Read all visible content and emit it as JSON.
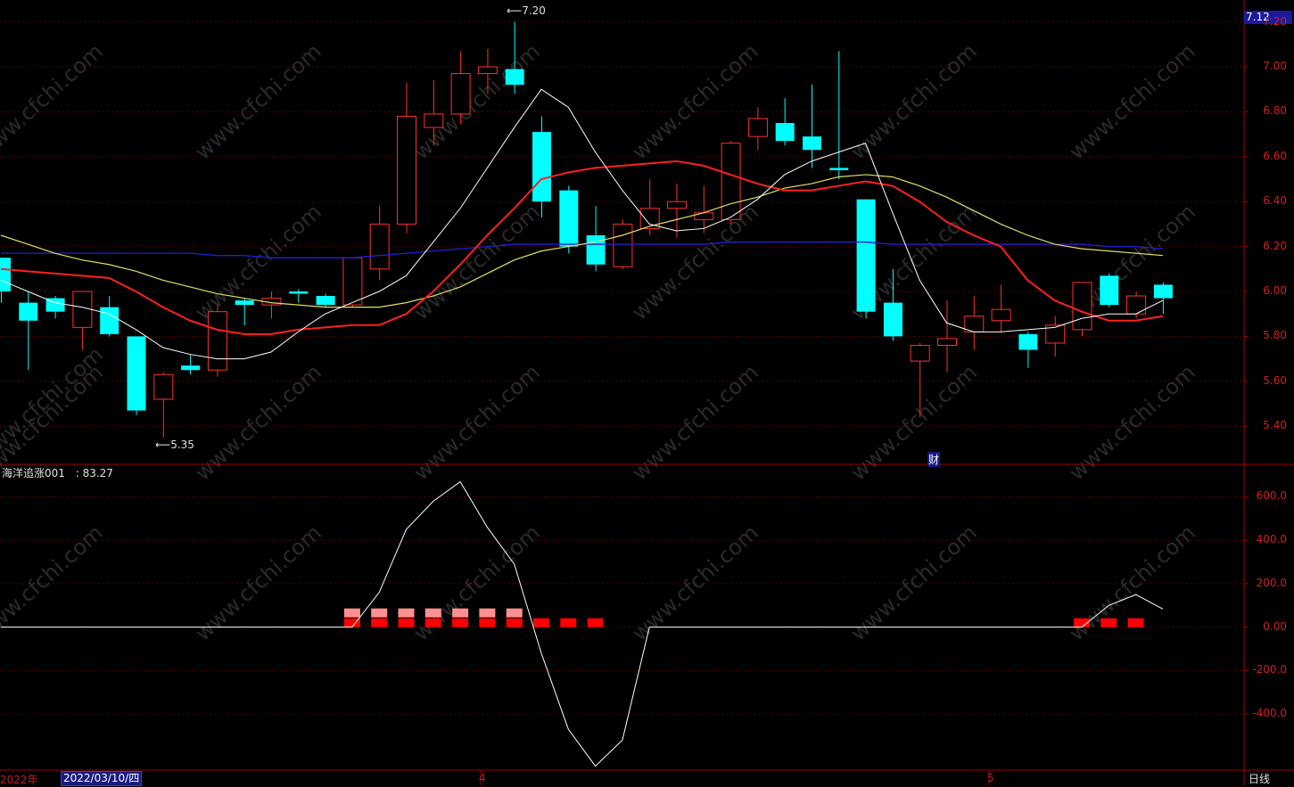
{
  "indicator": {
    "name": "海洋追涨001",
    "value_label": ": 83.27"
  },
  "price_axis": [
    "7.20",
    "7.00",
    "6.80",
    "6.60",
    "6.40",
    "6.20",
    "6.00",
    "5.80",
    "5.60",
    "5.40"
  ],
  "indicator_axis": [
    "600.0",
    "400.0",
    "200.0",
    "0.00",
    "-200.0",
    "-400.0"
  ],
  "current_price": "7.12",
  "annotations": {
    "high": "7.20",
    "low": "5.35",
    "finance_marker": "财"
  },
  "date_axis": {
    "year": "2022年",
    "selected_date": "2022/03/10/四",
    "month_4": "4",
    "month_5": "5"
  },
  "period_tab": "日线",
  "watermark": "www.cfchi.com",
  "colors": {
    "up": "#ff3030",
    "down": "#00ffff",
    "ma5": "#ffffff",
    "ma10": "#ff2020",
    "ma20": "#e0e060",
    "ma60": "#2020d0",
    "grid": "#5a0000"
  },
  "chart_data": {
    "type": "candlestick",
    "candles": [
      {
        "o": 6.15,
        "c": 6.0,
        "h": 6.15,
        "l": 5.95
      },
      {
        "o": 5.95,
        "c": 5.87,
        "h": 6.0,
        "l": 5.65
      },
      {
        "o": 5.97,
        "c": 5.91,
        "h": 5.98,
        "l": 5.88
      },
      {
        "o": 5.84,
        "c": 6.0,
        "h": 6.0,
        "l": 5.74
      },
      {
        "o": 5.93,
        "c": 5.81,
        "h": 5.98,
        "l": 5.8
      },
      {
        "o": 5.8,
        "c": 5.47,
        "h": 5.8,
        "l": 5.45
      },
      {
        "o": 5.52,
        "c": 5.63,
        "h": 5.64,
        "l": 5.35
      },
      {
        "o": 5.67,
        "c": 5.65,
        "h": 5.72,
        "l": 5.63
      },
      {
        "o": 5.65,
        "c": 5.91,
        "h": 5.94,
        "l": 5.62
      },
      {
        "o": 5.96,
        "c": 5.94,
        "h": 5.97,
        "l": 5.85
      },
      {
        "o": 5.94,
        "c": 5.97,
        "h": 6.0,
        "l": 5.88
      },
      {
        "o": 6.0,
        "c": 5.99,
        "h": 6.01,
        "l": 5.95
      },
      {
        "o": 5.98,
        "c": 5.94,
        "h": 5.99,
        "l": 5.93
      },
      {
        "o": 5.94,
        "c": 6.15,
        "h": 6.15,
        "l": 5.93
      },
      {
        "o": 6.1,
        "c": 6.3,
        "h": 6.38,
        "l": 6.05
      },
      {
        "o": 6.3,
        "c": 6.78,
        "h": 6.93,
        "l": 6.26
      },
      {
        "o": 6.73,
        "c": 6.79,
        "h": 6.94,
        "l": 6.65
      },
      {
        "o": 6.79,
        "c": 6.97,
        "h": 7.07,
        "l": 6.75
      },
      {
        "o": 6.97,
        "c": 7.0,
        "h": 7.08,
        "l": 6.88
      },
      {
        "o": 6.99,
        "c": 6.92,
        "h": 7.2,
        "l": 6.88
      },
      {
        "o": 6.71,
        "c": 6.4,
        "h": 6.78,
        "l": 6.33
      },
      {
        "o": 6.45,
        "c": 6.2,
        "h": 6.47,
        "l": 6.17
      },
      {
        "o": 6.25,
        "c": 6.12,
        "h": 6.38,
        "l": 6.09
      },
      {
        "o": 6.11,
        "c": 6.3,
        "h": 6.32,
        "l": 6.1
      },
      {
        "o": 6.28,
        "c": 6.37,
        "h": 6.5,
        "l": 6.25
      },
      {
        "o": 6.37,
        "c": 6.4,
        "h": 6.48,
        "l": 6.24
      },
      {
        "o": 6.32,
        "c": 6.35,
        "h": 6.47,
        "l": 6.26
      },
      {
        "o": 6.32,
        "c": 6.66,
        "h": 6.67,
        "l": 6.3
      },
      {
        "o": 6.69,
        "c": 6.77,
        "h": 6.82,
        "l": 6.63
      },
      {
        "o": 6.75,
        "c": 6.67,
        "h": 6.86,
        "l": 6.65
      },
      {
        "o": 6.69,
        "c": 6.63,
        "h": 6.92,
        "l": 6.55
      },
      {
        "o": 6.55,
        "c": 6.54,
        "h": 7.07,
        "l": 6.5
      },
      {
        "o": 6.41,
        "c": 5.91,
        "h": 6.41,
        "l": 5.88
      },
      {
        "o": 5.95,
        "c": 5.8,
        "h": 6.1,
        "l": 5.78
      },
      {
        "o": 5.69,
        "c": 5.76,
        "h": 5.77,
        "l": 5.44
      },
      {
        "o": 5.76,
        "c": 5.79,
        "h": 5.96,
        "l": 5.64
      },
      {
        "o": 5.82,
        "c": 5.89,
        "h": 5.98,
        "l": 5.74
      },
      {
        "o": 5.87,
        "c": 5.92,
        "h": 6.03,
        "l": 5.82
      },
      {
        "o": 5.81,
        "c": 5.74,
        "h": 5.82,
        "l": 5.66
      },
      {
        "o": 5.77,
        "c": 5.85,
        "h": 5.89,
        "l": 5.71
      },
      {
        "o": 5.83,
        "c": 6.04,
        "h": 6.04,
        "l": 5.8
      },
      {
        "o": 6.07,
        "c": 5.94,
        "h": 6.08,
        "l": 5.93
      },
      {
        "o": 5.9,
        "c": 5.98,
        "h": 6.0,
        "l": 5.88
      },
      {
        "o": 6.03,
        "c": 5.97,
        "h": 6.04,
        "l": 5.9
      }
    ],
    "ma5": [
      6.05,
      6.0,
      5.95,
      5.93,
      5.9,
      5.83,
      5.75,
      5.72,
      5.7,
      5.7,
      5.73,
      5.82,
      5.9,
      5.95,
      6.0,
      6.07,
      6.22,
      6.37,
      6.55,
      6.73,
      6.9,
      6.82,
      6.62,
      6.45,
      6.3,
      6.27,
      6.28,
      6.33,
      6.41,
      6.52,
      6.58,
      6.62,
      6.66,
      6.35,
      6.05,
      5.86,
      5.82,
      5.82,
      5.83,
      5.84,
      5.88,
      5.9,
      5.9,
      5.96
    ],
    "ma10": [
      6.1,
      6.09,
      6.08,
      6.07,
      6.06,
      6.0,
      5.93,
      5.87,
      5.83,
      5.81,
      5.81,
      5.83,
      5.84,
      5.85,
      5.85,
      5.9,
      6.0,
      6.12,
      6.25,
      6.37,
      6.5,
      6.53,
      6.55,
      6.56,
      6.57,
      6.58,
      6.56,
      6.52,
      6.48,
      6.45,
      6.45,
      6.47,
      6.49,
      6.47,
      6.4,
      6.31,
      6.25,
      6.2,
      6.05,
      5.96,
      5.91,
      5.87,
      5.87,
      5.89
    ],
    "ma20": [
      6.25,
      6.21,
      6.17,
      6.14,
      6.12,
      6.09,
      6.05,
      6.02,
      5.99,
      5.97,
      5.95,
      5.94,
      5.93,
      5.93,
      5.93,
      5.95,
      5.98,
      6.02,
      6.08,
      6.14,
      6.18,
      6.2,
      6.22,
      6.25,
      6.29,
      6.32,
      6.35,
      6.39,
      6.42,
      6.46,
      6.48,
      6.51,
      6.52,
      6.51,
      6.47,
      6.42,
      6.36,
      6.3,
      6.25,
      6.21,
      6.19,
      6.18,
      6.17,
      6.16
    ],
    "ma60": [
      6.17,
      6.17,
      6.17,
      6.17,
      6.17,
      6.17,
      6.17,
      6.17,
      6.16,
      6.16,
      6.15,
      6.15,
      6.15,
      6.15,
      6.16,
      6.17,
      6.18,
      6.19,
      6.2,
      6.21,
      6.21,
      6.21,
      6.21,
      6.21,
      6.21,
      6.21,
      6.21,
      6.22,
      6.22,
      6.22,
      6.22,
      6.22,
      6.22,
      6.21,
      6.21,
      6.21,
      6.21,
      6.21,
      6.21,
      6.21,
      6.21,
      6.2,
      6.2,
      6.19
    ],
    "indicator_line": [
      0,
      0,
      0,
      0,
      0,
      0,
      0,
      0,
      0,
      0,
      0,
      0,
      0,
      0,
      160,
      450,
      580,
      670,
      460,
      290,
      -120,
      -470,
      -640,
      -520,
      0,
      0,
      0,
      0,
      0,
      0,
      0,
      0,
      0,
      0,
      0,
      0,
      0,
      0,
      0,
      0,
      0,
      100,
      150,
      83.27
    ],
    "signal_bars": {
      "pink": [
        13,
        14,
        15,
        16,
        17,
        18,
        19
      ],
      "red": [
        13,
        14,
        15,
        16,
        17,
        18,
        19,
        20,
        21,
        22,
        40,
        41,
        42
      ]
    },
    "price_range": [
      5.25,
      7.25
    ],
    "indicator_range": [
      -650,
      680
    ]
  }
}
